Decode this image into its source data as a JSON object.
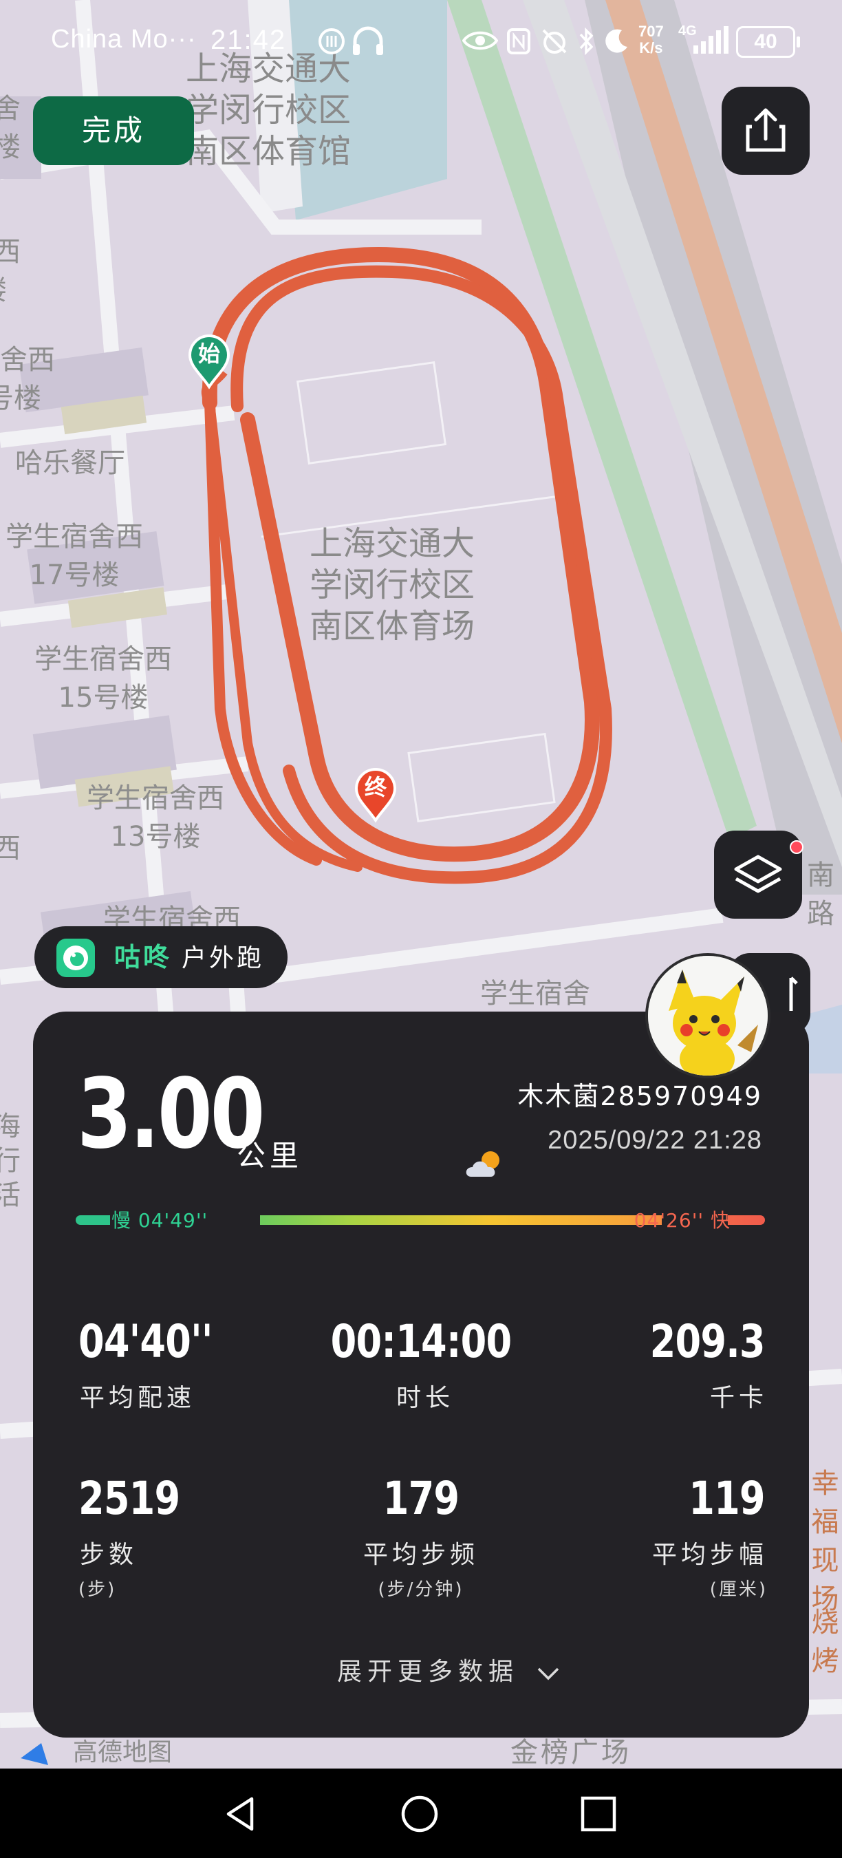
{
  "status_bar": {
    "carrier": "China Mo···",
    "time": "21:42",
    "net_speed_value": "707",
    "net_speed_unit": "K/s",
    "network": "4G",
    "battery": "40"
  },
  "map": {
    "labels": [
      "上海交通大\n学闵行校区\n南区体育馆",
      "上海交通大\n学闵行校区\n南区体育场",
      "哈乐餐厅",
      "学生宿舍西\n17号楼",
      "学生宿舍西\n15号楼",
      "学生宿舍西\n13号楼",
      "学生宿舍西",
      "学生宿舍",
      "宿舍西\n号楼",
      "舍西\n楼",
      "宿舍\n号楼",
      "南路",
      "幸福\n现场",
      "烧烤",
      "海\n行\n活",
      "西",
      "金榜广场",
      "高德地图"
    ],
    "start_marker": "始",
    "end_marker": "终",
    "provider": "高德地图"
  },
  "buttons": {
    "done": "完成"
  },
  "badge": {
    "app_name": "咕咚",
    "activity": "户外跑"
  },
  "summary": {
    "distance": "3.00",
    "distance_unit": "公里",
    "user": "木木菌285970949",
    "datetime": "2025/09/22 21:28",
    "pace_slow_label": "慢 04'49''",
    "pace_fast_label": "04'26'' 快",
    "stats": [
      {
        "value": "04'40''",
        "label": "平均配速",
        "sub": ""
      },
      {
        "value": "00:14:00",
        "label": "时长",
        "sub": ""
      },
      {
        "value": "209.3",
        "label": "千卡",
        "sub": ""
      },
      {
        "value": "2519",
        "label": "步数",
        "sub": "(步)"
      },
      {
        "value": "179",
        "label": "平均步频",
        "sub": "(步/分钟)"
      },
      {
        "value": "119",
        "label": "平均步幅",
        "sub": "(厘米)"
      }
    ],
    "expand_more": "展开更多数据"
  },
  "colors": {
    "route": "#e0603f",
    "done_button": "#0d6a45",
    "card": "#232226",
    "accent_green": "#2fd394",
    "accent_red": "#f4664f"
  },
  "icons": {
    "share": "share-icon",
    "layers": "layers-icon",
    "weather": "partly-cloudy-night-icon",
    "expand": "chevron-down-icon"
  }
}
